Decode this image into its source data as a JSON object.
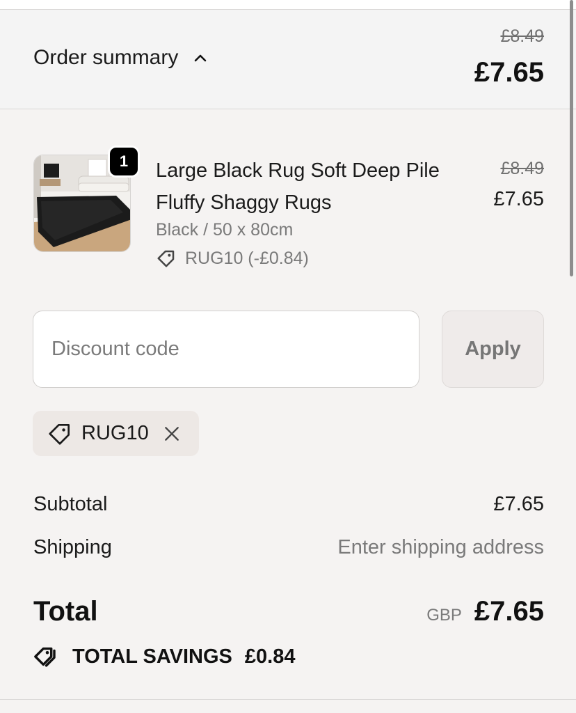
{
  "summary": {
    "title": "Order summary",
    "original_price": "£8.49",
    "price": "£7.65"
  },
  "item": {
    "quantity": "1",
    "name": "Large Black Rug Soft Deep Pile Fluffy Shaggy Rugs",
    "variant": "Black / 50 x 80cm",
    "discount": "RUG10 (-£0.84)",
    "original_price": "£8.49",
    "price": "£7.65"
  },
  "discount_form": {
    "placeholder": "Discount code",
    "value": "",
    "apply_label": "Apply"
  },
  "applied_code": {
    "code": "RUG10"
  },
  "totals": {
    "subtotal_label": "Subtotal",
    "subtotal_value": "£7.65",
    "shipping_label": "Shipping",
    "shipping_value": "Enter shipping address",
    "total_label": "Total",
    "currency": "GBP",
    "total_value": "£7.65",
    "savings_label": "TOTAL SAVINGS",
    "savings_value": "£0.84"
  },
  "icons": {
    "summary_toggle": "chevron-up-icon",
    "item_discount": "tag-icon",
    "remove_code": "close-icon",
    "savings": "tags-icon"
  },
  "colors": {
    "background": "#f5f3f2",
    "summary_bar": "#f4f4f4",
    "text": "#111111",
    "muted_text": "#7a7a7a",
    "chip": "#ede8e5",
    "apply_button": "#efebea"
  }
}
